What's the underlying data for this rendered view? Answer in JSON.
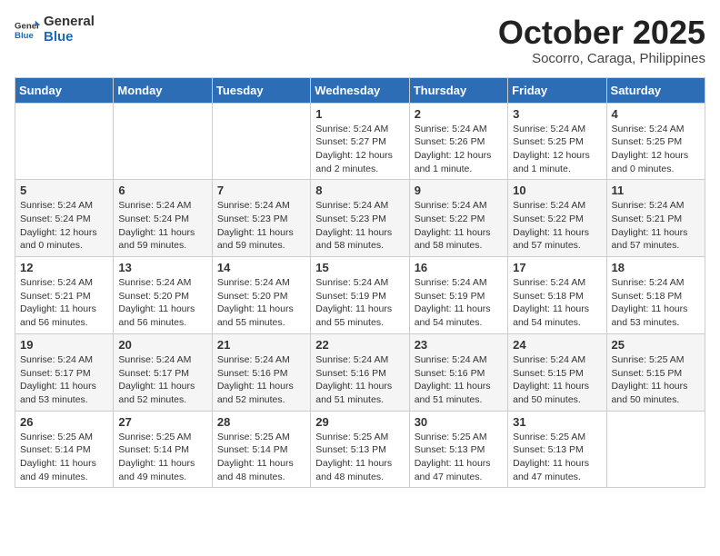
{
  "header": {
    "logo_general": "General",
    "logo_blue": "Blue",
    "month_title": "October 2025",
    "subtitle": "Socorro, Caraga, Philippines"
  },
  "weekdays": [
    "Sunday",
    "Monday",
    "Tuesday",
    "Wednesday",
    "Thursday",
    "Friday",
    "Saturday"
  ],
  "weeks": [
    [
      {
        "day": "",
        "info": ""
      },
      {
        "day": "",
        "info": ""
      },
      {
        "day": "",
        "info": ""
      },
      {
        "day": "1",
        "info": "Sunrise: 5:24 AM\nSunset: 5:27 PM\nDaylight: 12 hours\nand 2 minutes."
      },
      {
        "day": "2",
        "info": "Sunrise: 5:24 AM\nSunset: 5:26 PM\nDaylight: 12 hours\nand 1 minute."
      },
      {
        "day": "3",
        "info": "Sunrise: 5:24 AM\nSunset: 5:25 PM\nDaylight: 12 hours\nand 1 minute."
      },
      {
        "day": "4",
        "info": "Sunrise: 5:24 AM\nSunset: 5:25 PM\nDaylight: 12 hours\nand 0 minutes."
      }
    ],
    [
      {
        "day": "5",
        "info": "Sunrise: 5:24 AM\nSunset: 5:24 PM\nDaylight: 12 hours\nand 0 minutes."
      },
      {
        "day": "6",
        "info": "Sunrise: 5:24 AM\nSunset: 5:24 PM\nDaylight: 11 hours\nand 59 minutes."
      },
      {
        "day": "7",
        "info": "Sunrise: 5:24 AM\nSunset: 5:23 PM\nDaylight: 11 hours\nand 59 minutes."
      },
      {
        "day": "8",
        "info": "Sunrise: 5:24 AM\nSunset: 5:23 PM\nDaylight: 11 hours\nand 58 minutes."
      },
      {
        "day": "9",
        "info": "Sunrise: 5:24 AM\nSunset: 5:22 PM\nDaylight: 11 hours\nand 58 minutes."
      },
      {
        "day": "10",
        "info": "Sunrise: 5:24 AM\nSunset: 5:22 PM\nDaylight: 11 hours\nand 57 minutes."
      },
      {
        "day": "11",
        "info": "Sunrise: 5:24 AM\nSunset: 5:21 PM\nDaylight: 11 hours\nand 57 minutes."
      }
    ],
    [
      {
        "day": "12",
        "info": "Sunrise: 5:24 AM\nSunset: 5:21 PM\nDaylight: 11 hours\nand 56 minutes."
      },
      {
        "day": "13",
        "info": "Sunrise: 5:24 AM\nSunset: 5:20 PM\nDaylight: 11 hours\nand 56 minutes."
      },
      {
        "day": "14",
        "info": "Sunrise: 5:24 AM\nSunset: 5:20 PM\nDaylight: 11 hours\nand 55 minutes."
      },
      {
        "day": "15",
        "info": "Sunrise: 5:24 AM\nSunset: 5:19 PM\nDaylight: 11 hours\nand 55 minutes."
      },
      {
        "day": "16",
        "info": "Sunrise: 5:24 AM\nSunset: 5:19 PM\nDaylight: 11 hours\nand 54 minutes."
      },
      {
        "day": "17",
        "info": "Sunrise: 5:24 AM\nSunset: 5:18 PM\nDaylight: 11 hours\nand 54 minutes."
      },
      {
        "day": "18",
        "info": "Sunrise: 5:24 AM\nSunset: 5:18 PM\nDaylight: 11 hours\nand 53 minutes."
      }
    ],
    [
      {
        "day": "19",
        "info": "Sunrise: 5:24 AM\nSunset: 5:17 PM\nDaylight: 11 hours\nand 53 minutes."
      },
      {
        "day": "20",
        "info": "Sunrise: 5:24 AM\nSunset: 5:17 PM\nDaylight: 11 hours\nand 52 minutes."
      },
      {
        "day": "21",
        "info": "Sunrise: 5:24 AM\nSunset: 5:16 PM\nDaylight: 11 hours\nand 52 minutes."
      },
      {
        "day": "22",
        "info": "Sunrise: 5:24 AM\nSunset: 5:16 PM\nDaylight: 11 hours\nand 51 minutes."
      },
      {
        "day": "23",
        "info": "Sunrise: 5:24 AM\nSunset: 5:16 PM\nDaylight: 11 hours\nand 51 minutes."
      },
      {
        "day": "24",
        "info": "Sunrise: 5:24 AM\nSunset: 5:15 PM\nDaylight: 11 hours\nand 50 minutes."
      },
      {
        "day": "25",
        "info": "Sunrise: 5:25 AM\nSunset: 5:15 PM\nDaylight: 11 hours\nand 50 minutes."
      }
    ],
    [
      {
        "day": "26",
        "info": "Sunrise: 5:25 AM\nSunset: 5:14 PM\nDaylight: 11 hours\nand 49 minutes."
      },
      {
        "day": "27",
        "info": "Sunrise: 5:25 AM\nSunset: 5:14 PM\nDaylight: 11 hours\nand 49 minutes."
      },
      {
        "day": "28",
        "info": "Sunrise: 5:25 AM\nSunset: 5:14 PM\nDaylight: 11 hours\nand 48 minutes."
      },
      {
        "day": "29",
        "info": "Sunrise: 5:25 AM\nSunset: 5:13 PM\nDaylight: 11 hours\nand 48 minutes."
      },
      {
        "day": "30",
        "info": "Sunrise: 5:25 AM\nSunset: 5:13 PM\nDaylight: 11 hours\nand 47 minutes."
      },
      {
        "day": "31",
        "info": "Sunrise: 5:25 AM\nSunset: 5:13 PM\nDaylight: 11 hours\nand 47 minutes."
      },
      {
        "day": "",
        "info": ""
      }
    ]
  ],
  "colors": {
    "header_bg": "#2d6db5",
    "row_odd": "#ffffff",
    "row_even": "#f2f2f2"
  }
}
